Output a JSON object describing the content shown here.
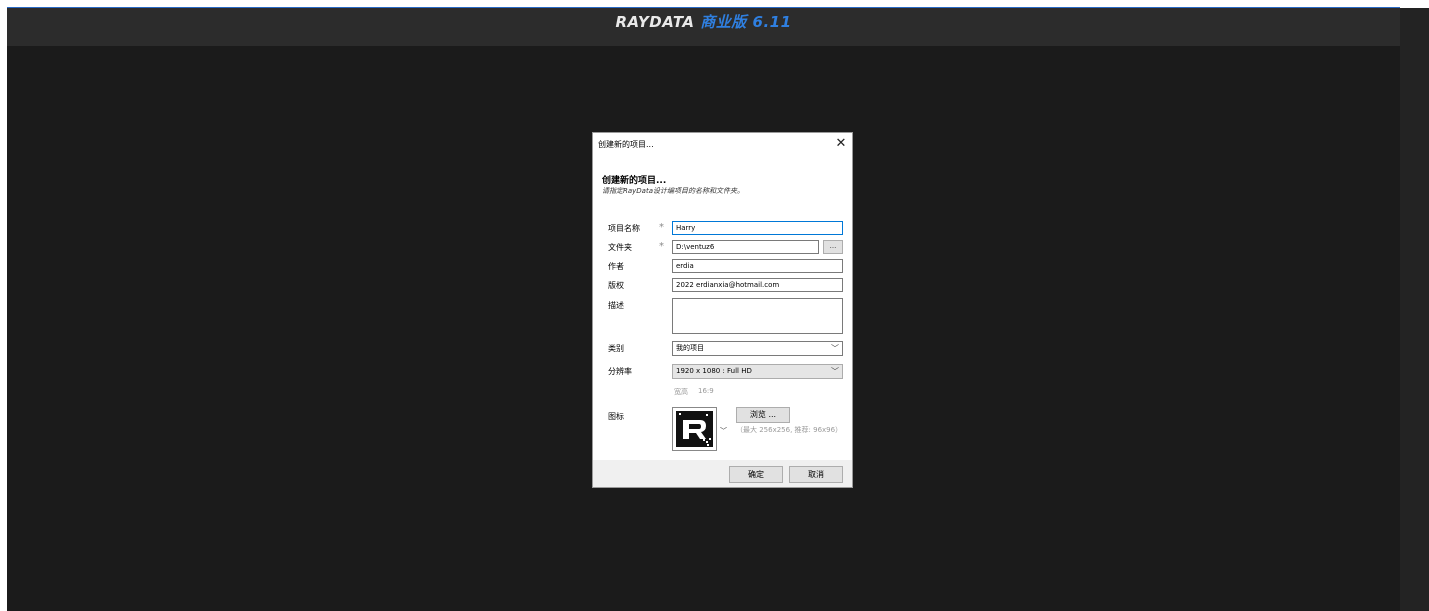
{
  "app": {
    "brand": "RAYDATA",
    "edition": "商业版",
    "version": "6.11"
  },
  "dialog": {
    "title": "创建新的项目...",
    "heading": "创建新的项目...",
    "subheading": "请指定RayData设计编项目的名称和文件夹。",
    "fields": {
      "project_name": {
        "label": "项目名称",
        "value": "Harry"
      },
      "folder": {
        "label": "文件夹",
        "value": "D:\\ventuz6",
        "browse": "..."
      },
      "author": {
        "label": "作者",
        "value": "erdia"
      },
      "copyright": {
        "label": "版权",
        "value": "2022 erdianxia@hotmail.com"
      },
      "description": {
        "label": "描述",
        "value": ""
      },
      "category": {
        "label": "类别",
        "value": "我的项目"
      },
      "resolution": {
        "label": "分辨率",
        "value": "1920 x 1080 : Full HD"
      },
      "aspect": {
        "label": "宽高",
        "value": "16:9"
      },
      "icon": {
        "label": "图标",
        "browse": "浏览 ...",
        "hint": "（最大 256x256, 推荐: 96x96）"
      }
    },
    "required_marker": "*",
    "buttons": {
      "ok": "确定",
      "cancel": "取消"
    }
  },
  "colors": {
    "app_bg": "#1b1b1b",
    "header_bg": "#2c2c2c",
    "accent": "#2f7fe0",
    "dialog_bg": "#f0f0f0"
  }
}
